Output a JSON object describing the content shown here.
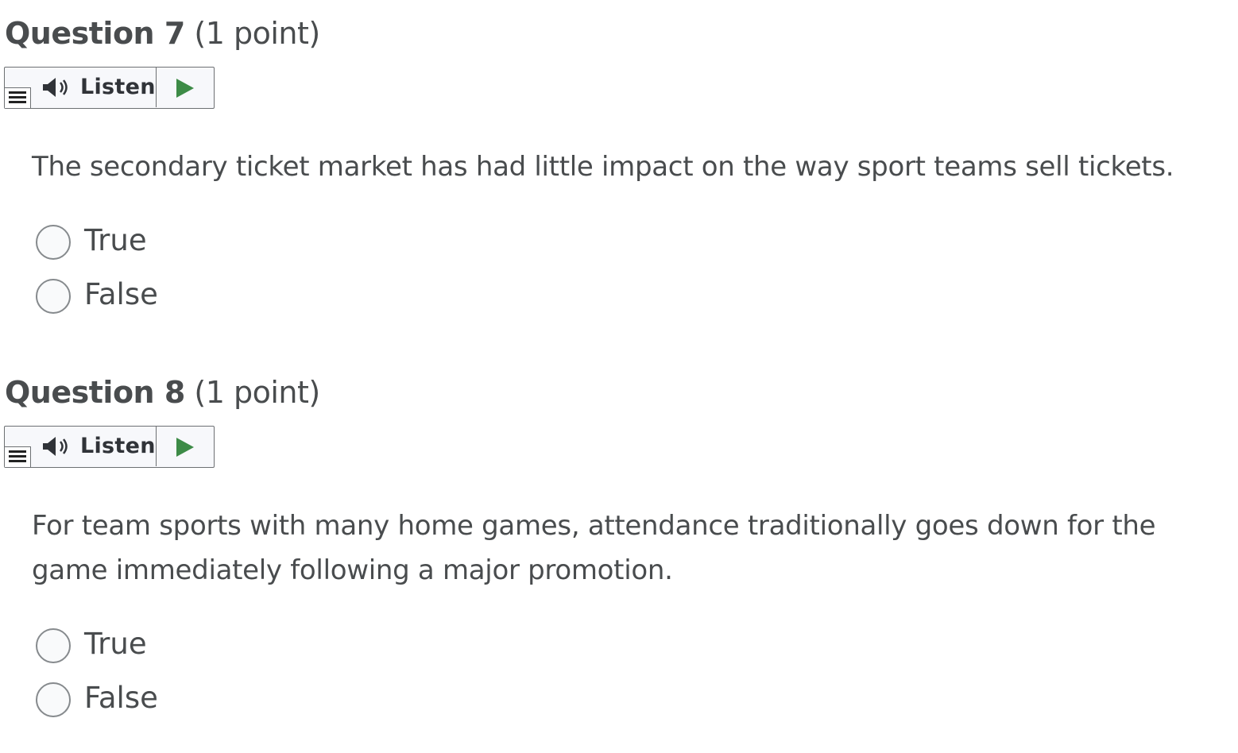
{
  "questions": [
    {
      "title": "Question 7",
      "points": "(1 point)",
      "listen_label": "Listen",
      "text": "The secondary ticket market has had little impact on the way sport teams sell tickets.",
      "options": [
        {
          "label": "True",
          "selected": false
        },
        {
          "label": "False",
          "selected": false
        }
      ]
    },
    {
      "title": "Question 8",
      "points": "(1 point)",
      "listen_label": "Listen",
      "text": "For team sports with many home games, attendance traditionally goes down for the game immediately following a major promotion.",
      "options": [
        {
          "label": "True",
          "selected": false
        },
        {
          "label": "False",
          "selected": false
        }
      ]
    }
  ],
  "colors": {
    "text": "#494c4e",
    "play_icon": "#3d8b47",
    "border": "#6d7073"
  },
  "icons": {
    "menu": "menu-icon",
    "speaker": "speaker-icon",
    "play": "play-icon"
  }
}
